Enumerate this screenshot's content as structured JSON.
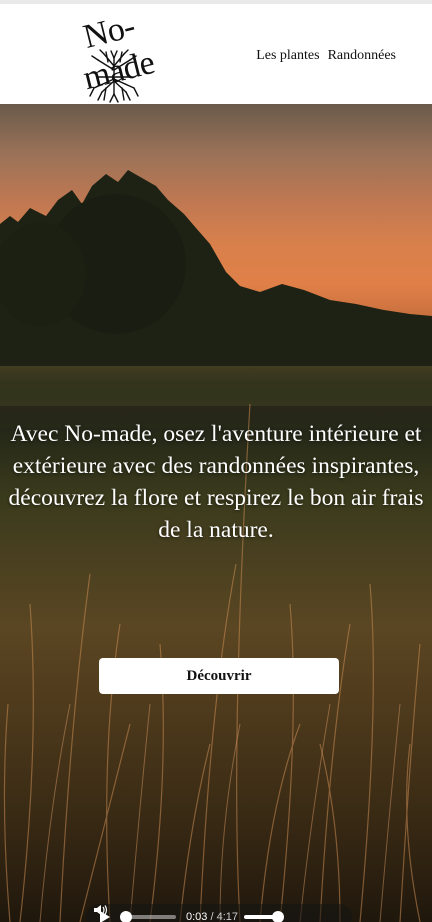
{
  "header": {
    "logo_text": "No-made",
    "nav": [
      {
        "label": "Les plantes"
      },
      {
        "label": "Randonnées"
      }
    ]
  },
  "hero": {
    "text": "Avec No-made, osez l'aventure intérieure et extérieure avec des randonnées inspirantes, découvrez la flore et respirez le bon air frais de la nature.",
    "button_label": "Découvrir"
  },
  "audio": {
    "current_time": "0:03",
    "separator": "/",
    "duration": "4:17",
    "progress": 0.012,
    "volume": 1.0
  },
  "colors": {
    "accent_sky": "#e08048",
    "button_bg": "#ffffff",
    "text_on_hero": "#ffffff"
  },
  "icons": [
    "tree-icon",
    "play-icon",
    "volume-icon"
  ]
}
